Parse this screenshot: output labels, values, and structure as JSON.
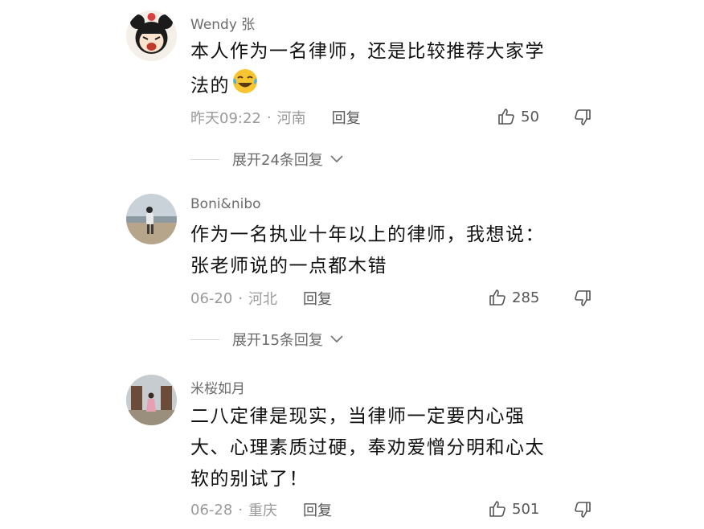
{
  "comments": [
    {
      "username": "Wendy 张",
      "line1": "本人作为一名律师，还是比较推荐大家学",
      "line2": "法的",
      "time": "昨天09:22",
      "dot": "·",
      "location": "河南",
      "reply_label": "回复",
      "likes": "50",
      "expand_label": "展开24条回复",
      "emoji_icon": "laughing-tears-emoji"
    },
    {
      "username": "Boni&nibo",
      "line1": "作为一名执业十年以上的律师，我想说：",
      "line2": "张老师说的一点都木错",
      "time": "06-20",
      "dot": "·",
      "location": "河北",
      "reply_label": "回复",
      "likes": "285",
      "expand_label": "展开15条回复"
    },
    {
      "username": "米桜如月",
      "line1": "二八定律是现实，当律师一定要内心强",
      "line2": "大、心理素质过硬，奉劝爱憎分明和心太",
      "line3": "软的别试了！",
      "time": "06-28",
      "dot": "·",
      "location": "重庆",
      "reply_label": "回复",
      "likes": "501"
    }
  ],
  "colors": {
    "meta": "#9a9a9a",
    "text": "#111111",
    "username": "#6b6b6b"
  }
}
